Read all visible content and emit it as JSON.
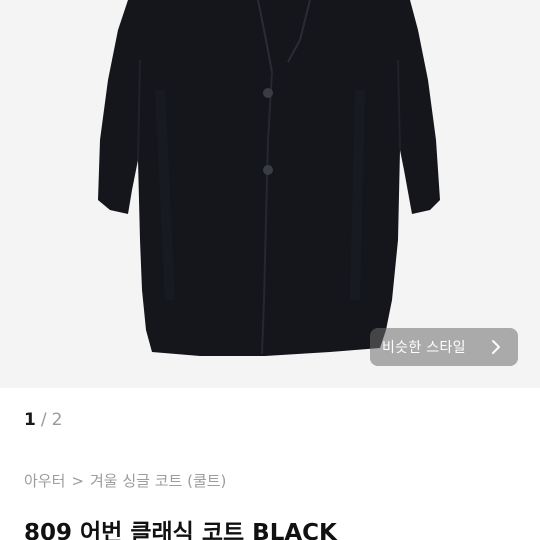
{
  "product_image": {
    "icon": "black-single-coat-image",
    "colors": {
      "background": "#f4f4f4",
      "coat": "#14161c",
      "lining": "#4a4c55"
    }
  },
  "similar_style": {
    "label": "비슷한 스타일",
    "icon": "chevron-right-icon"
  },
  "pager": {
    "current": "1",
    "separator": "/",
    "total": "2"
  },
  "breadcrumb": {
    "category": "아우터",
    "separator": ">",
    "subcategory": "겨울 싱글 코트 (쿨트)"
  },
  "product": {
    "title": "809 어번 클래식 코트 BLACK"
  }
}
